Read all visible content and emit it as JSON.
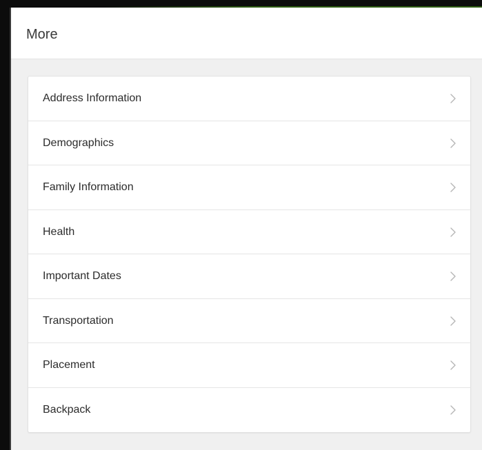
{
  "header": {
    "title": "More"
  },
  "menu": {
    "items": [
      {
        "label": "Address Information"
      },
      {
        "label": "Demographics"
      },
      {
        "label": "Family Information"
      },
      {
        "label": "Health"
      },
      {
        "label": "Important Dates"
      },
      {
        "label": "Transportation"
      },
      {
        "label": "Placement"
      },
      {
        "label": "Backpack"
      }
    ]
  },
  "icons": {
    "row_arrow": "chevron-right-icon"
  },
  "colors": {
    "background": "#f0f0f0",
    "card": "#ffffff",
    "text": "#2b2b2b",
    "chevron": "#b5b5b5",
    "divider": "#e5e5e5"
  }
}
